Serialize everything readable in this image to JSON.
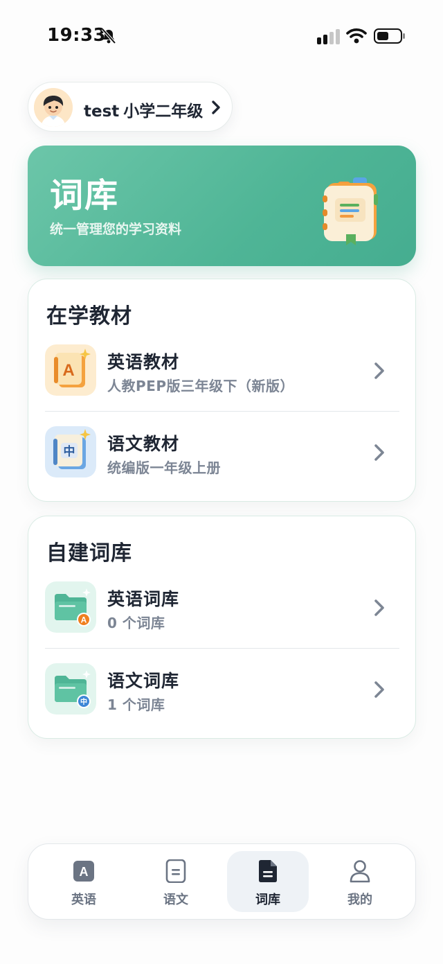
{
  "status_bar": {
    "time": "19:33"
  },
  "profile": {
    "name": "test",
    "grade": "小学二年级"
  },
  "banner": {
    "title": "词库",
    "subtitle": "统一管理您的学习资料"
  },
  "studying": {
    "title": "在学教材",
    "items": [
      {
        "title": "英语教材",
        "subtitle": "人教PEP版三年级下（新版）",
        "icon": "english-book-icon"
      },
      {
        "title": "语文教材",
        "subtitle": "统编版一年级上册",
        "icon": "chinese-book-icon"
      }
    ]
  },
  "custom": {
    "title": "自建词库",
    "items": [
      {
        "title": "英语词库",
        "subtitle": "0 个词库",
        "icon": "english-folder-icon"
      },
      {
        "title": "语文词库",
        "subtitle": "1 个词库",
        "icon": "chinese-folder-icon"
      }
    ]
  },
  "nav": {
    "items": [
      {
        "label": "英语",
        "icon": "english-a-icon"
      },
      {
        "label": "语文",
        "icon": "document-icon"
      },
      {
        "label": "词库",
        "icon": "wordbank-doc-icon",
        "active": true
      },
      {
        "label": "我的",
        "icon": "person-icon"
      }
    ]
  },
  "colors": {
    "accent": "#4fb596",
    "banner_light": "#6cc6a9",
    "text_primary": "#1f2633",
    "text_secondary": "#7c8594",
    "nav_active_bg": "#eef2f6"
  }
}
